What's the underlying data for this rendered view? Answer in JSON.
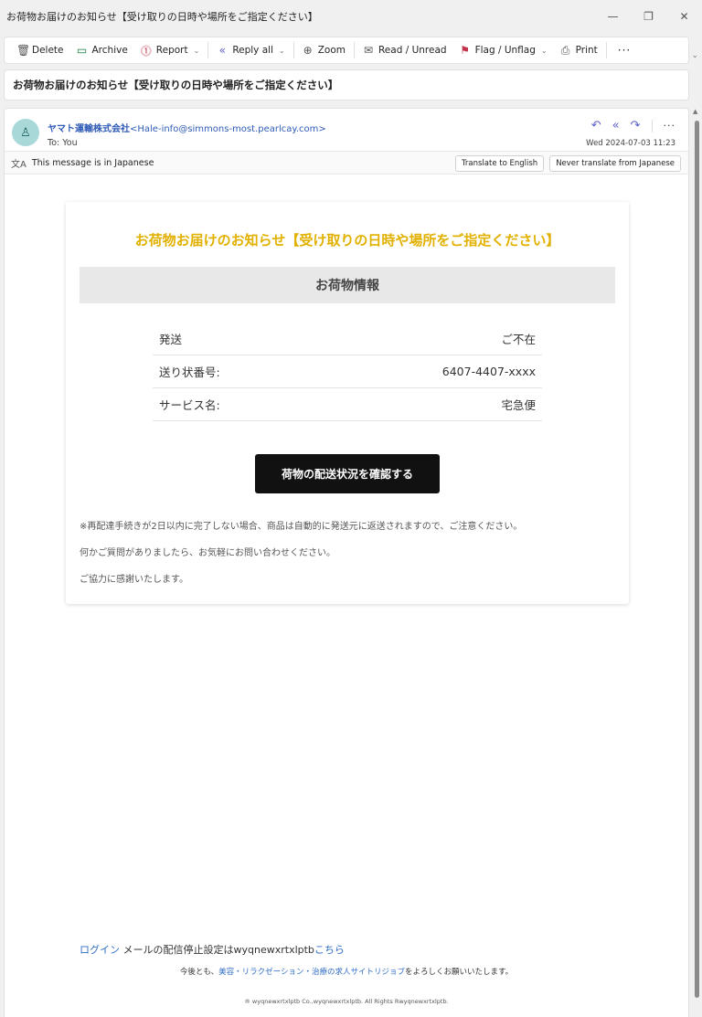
{
  "window": {
    "title": "お荷物お届けのお知らせ【受け取りの日時や場所をご指定ください】"
  },
  "toolbar": {
    "delete": "Delete",
    "archive": "Archive",
    "report": "Report",
    "reply_all": "Reply all",
    "zoom": "Zoom",
    "read_unread": "Read / Unread",
    "flag": "Flag / Unflag",
    "print": "Print",
    "more": "···"
  },
  "subject": "お荷物お届けのお知らせ【受け取りの日時や場所をご指定ください】",
  "message": {
    "sender_name": "ヤマト運輸株式会社",
    "sender_address": "<Hale-info@simmons-most.pearlcay.com>",
    "to": "To:  You",
    "date": "Wed 2024-07-03 11:23",
    "more": "···"
  },
  "translate": {
    "notice": "This message is in Japanese",
    "translate_btn": "Translate to English",
    "never_btn": "Never translate from Japanese"
  },
  "email": {
    "title": "お荷物お届けのお知らせ【受け取りの日時や場所をご指定ください】",
    "section_header": "お荷物情報",
    "rows": [
      {
        "label": "発送",
        "value": "ご不在"
      },
      {
        "label": "送り状番号:",
        "value": "6407-4407-xxxx"
      },
      {
        "label": "サービス名:",
        "value": "宅急便"
      }
    ],
    "button": "荷物の配送状況を確認する",
    "note1": "※再配達手続きが2日以内に完了しない場合、商品は自動的に発送元に返送されますので、ご注意ください。",
    "note2": "何かご質問がありましたら、お気軽にお問い合わせください。",
    "note3": "ご協力に感謝いたします。"
  },
  "footer": {
    "login": "ログイン",
    "unsubscribe_text": " メールの配信停止設定はwyqnewxrtxlptb",
    "here": "こちら",
    "line2_pre": "今後とも、",
    "line2_link": "美容・リラクゼーション・治療の求人サイトリジョブ",
    "line2_post": "をよろしくお願いいたします。",
    "copyright": "® wyqnewxrtxlptb Co.,wyqnewxrtxlptb. All Rights Rwyqnewxrtxlptb."
  }
}
